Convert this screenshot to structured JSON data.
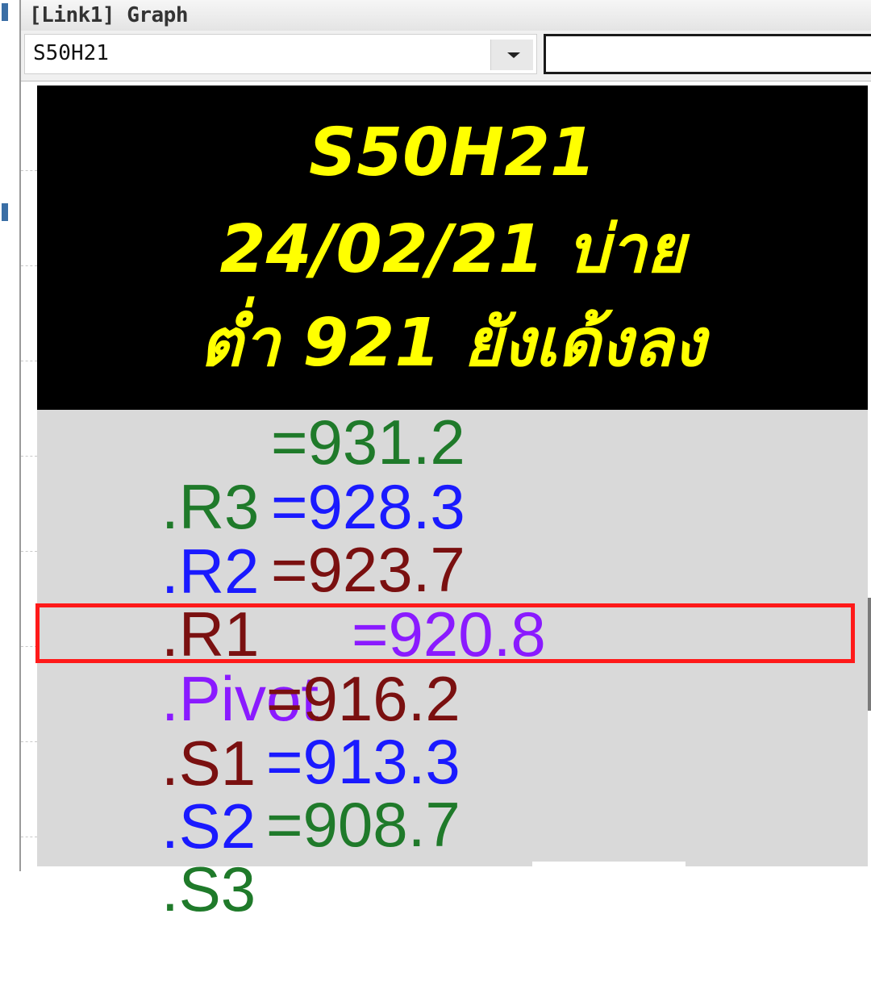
{
  "window": {
    "title": "[Link1] Graph"
  },
  "toolbar": {
    "symbol_value": "S50H21",
    "text_value": ""
  },
  "banner": {
    "line1": "S50H21",
    "line2": "24/02/21 บ่าย",
    "line3": "ต่ำ 921 ยังเด้งลง",
    "color": "#ffff00",
    "background": "#000000"
  },
  "levels": [
    {
      "label": ".R3",
      "value": "=931.2",
      "color": "#1f7a2a"
    },
    {
      "label": ".R2",
      "value": "=928.3",
      "color": "#1a1aff"
    },
    {
      "label": ".R1",
      "value": "=923.7",
      "color": "#7a1010"
    },
    {
      "label": ".Pivot",
      "value": "=920.8",
      "color": "#8a1aff",
      "highlight": true
    },
    {
      "label": ".S1",
      "value": "=916.2",
      "color": "#7a1010"
    },
    {
      "label": ".S2",
      "value": "=913.3",
      "color": "#1a1aff"
    },
    {
      "label": ".S3",
      "value": "=908.7",
      "color": "#1f7a2a"
    }
  ],
  "colors": {
    "highlight_box": "#ff1a1a",
    "levels_background": "#d9d9d9"
  }
}
